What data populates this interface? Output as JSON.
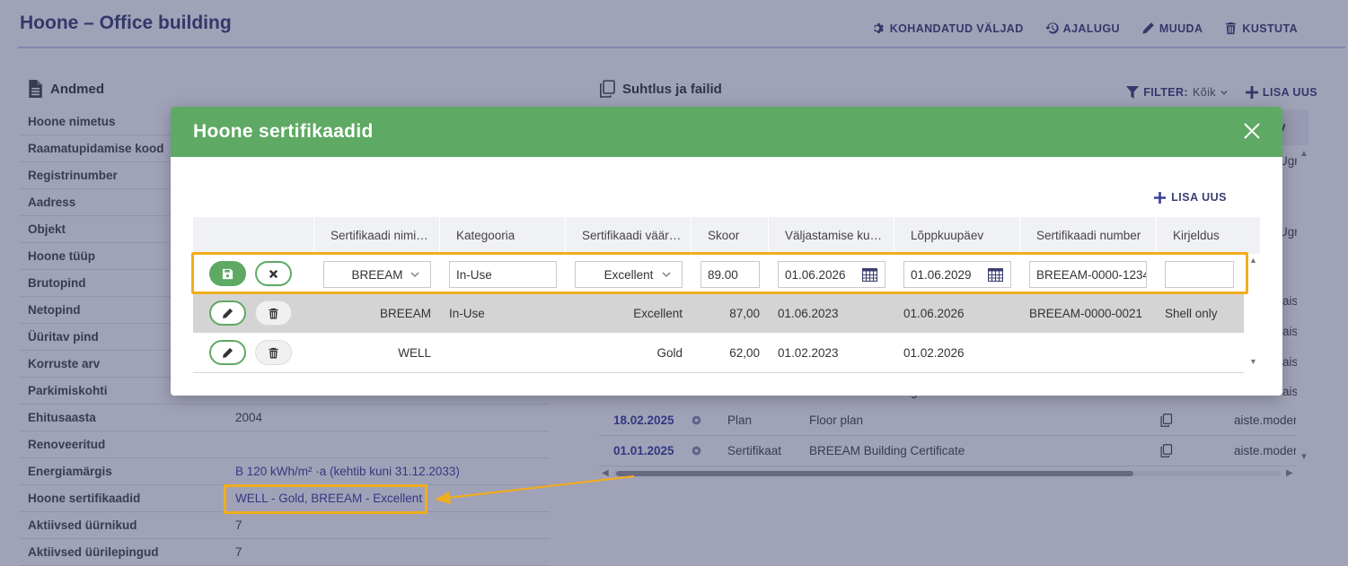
{
  "page": {
    "title": "Hoone – Office building",
    "actions": [
      {
        "label": "KOHANDATUD VÄLJAD",
        "icon": "gear-icon"
      },
      {
        "label": "AJALUGU",
        "icon": "history-icon"
      },
      {
        "label": "MUUDA",
        "icon": "pencil-icon"
      },
      {
        "label": "KUSTUTA",
        "icon": "trash-icon"
      }
    ]
  },
  "andmed": {
    "heading": "Andmed",
    "rows": [
      {
        "label": "Hoone nimetus",
        "value": ""
      },
      {
        "label": "Raamatupidamise kood",
        "value": ""
      },
      {
        "label": "Registrinumber",
        "value": ""
      },
      {
        "label": "Aadress",
        "value": ""
      },
      {
        "label": "Objekt",
        "value": ""
      },
      {
        "label": "Hoone tüüp",
        "value": ""
      },
      {
        "label": "Brutopind",
        "value": ""
      },
      {
        "label": "Netopind",
        "value": ""
      },
      {
        "label": "Üüritav pind",
        "value": ""
      },
      {
        "label": "Korruste arv",
        "value": ""
      },
      {
        "label": "Parkimiskohti",
        "value": ""
      },
      {
        "label": "Ehitusaasta",
        "value": "2004"
      },
      {
        "label": "Renoveeritud",
        "value": ""
      },
      {
        "label": "Energiamärgis",
        "value": "B 120 kWh/m² ·a (kehtib kuni 31.12.2033)"
      },
      {
        "label": "Hoone sertifikaadid",
        "value": "WELL - Gold, BREEAM - Excellent"
      },
      {
        "label": "Aktiivsed üürnikud",
        "value": "7"
      },
      {
        "label": "Aktiivsed üürilepingud",
        "value": "7"
      }
    ]
  },
  "suhtlus": {
    "heading": "Suhtlus ja failid",
    "filter_label": "FILTER:",
    "filter_value": "Kõik",
    "add_label": "LISA UUS",
    "header_peek": "v",
    "side_peeks": [
      "Ugr",
      "Ugr",
      "aiste.moder",
      "aiste.moder",
      "aiste.moder",
      "aiste.moder"
    ],
    "peek_partial": "g",
    "rows": [
      {
        "date": "18.02.2025",
        "type": "Plan",
        "name": "Floor plan",
        "user": "aiste.moder"
      },
      {
        "date": "01.01.2025",
        "type": "Sertifikaat",
        "name": "BREEAM Building Certificate",
        "user": "aiste.moder"
      }
    ]
  },
  "modal": {
    "title": "Hoone sertifikaadid",
    "add_label": "LISA UUS",
    "columns": [
      "Sertifikaadi nimi…",
      "Kategooria",
      "Sertifikaadi väär…",
      "Skoor",
      "Väljastamise ku…",
      "Lõppkuupäev",
      "Sertifikaadi number",
      "Kirjeldus"
    ],
    "edit_row": {
      "name": "BREEAM",
      "category": "In-Use",
      "value": "Excellent",
      "score": "89.00",
      "issued": "01.06.2026",
      "expires": "01.06.2029",
      "number": "BREEAM-0000-1234",
      "description": ""
    },
    "rows": [
      {
        "name": "BREEAM",
        "category": "In-Use",
        "value": "Excellent",
        "score": "87,00",
        "issued": "01.06.2023",
        "expires": "01.06.2026",
        "number": "BREEAM-0000-0021",
        "description": "Shell only"
      },
      {
        "name": "WELL",
        "category": "",
        "value": "Gold",
        "score": "62,00",
        "issued": "01.02.2023",
        "expires": "01.02.2026",
        "number": "",
        "description": ""
      }
    ]
  },
  "colors": {
    "accent": "#5ea964",
    "brand": "#3a3f70",
    "highlight": "#f0ad1e",
    "overlay": "#2c3062"
  }
}
